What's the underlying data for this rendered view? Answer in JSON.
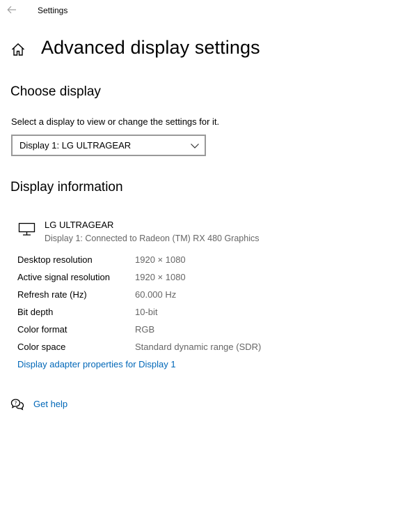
{
  "window": {
    "title": "Settings"
  },
  "header": {
    "page_title": "Advanced display settings"
  },
  "choose_display": {
    "heading": "Choose display",
    "helper": "Select a display to view or change the settings for it.",
    "selected_display": "Display 1: LG ULTRAGEAR"
  },
  "display_information": {
    "heading": "Display information",
    "monitor_name": "LG ULTRAGEAR",
    "connection": "Display 1: Connected to Radeon (TM) RX 480 Graphics",
    "rows": [
      {
        "label": "Desktop resolution",
        "value": "1920 × 1080"
      },
      {
        "label": "Active signal resolution",
        "value": "1920 × 1080"
      },
      {
        "label": "Refresh rate (Hz)",
        "value": "60.000 Hz"
      },
      {
        "label": "Bit depth",
        "value": "10-bit"
      },
      {
        "label": "Color format",
        "value": "RGB"
      },
      {
        "label": "Color space",
        "value": "Standard dynamic range (SDR)"
      }
    ],
    "adapter_link": "Display adapter properties for Display 1"
  },
  "help": {
    "label": "Get help"
  },
  "colors": {
    "link": "#0067b8",
    "secondary_text": "#666666",
    "dropdown_border": "#999999"
  },
  "icons": [
    "back-arrow-icon",
    "home-icon",
    "chevron-down-icon",
    "monitor-icon",
    "help-chat-icon"
  ]
}
